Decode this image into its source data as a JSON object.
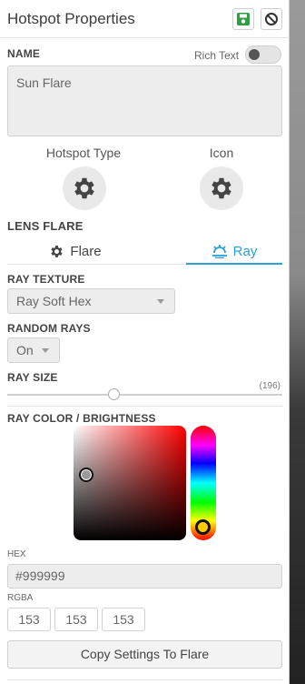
{
  "header": {
    "title": "Hotspot Properties",
    "save_icon": "save-icon",
    "disable_icon": "ban-icon",
    "save_color": "#2e9e44"
  },
  "name_section": {
    "label": "NAME",
    "rich_text_label": "Rich Text",
    "rich_text_enabled": false,
    "value": "Sun Flare"
  },
  "types": {
    "hotspot_type_label": "Hotspot Type",
    "icon_label": "Icon",
    "hotspot_type_icon": "gear-icon",
    "icon_icon": "gear-icon"
  },
  "lens_flare": {
    "label": "LENS FLARE",
    "tabs": [
      {
        "label": "Flare",
        "icon": "gear-icon",
        "active": false
      },
      {
        "label": "Ray",
        "icon": "ray-icon",
        "active": true
      }
    ],
    "accent": "#29a0d8"
  },
  "ray_texture": {
    "label": "RAY TEXTURE",
    "value": "Ray Soft Hex"
  },
  "random_rays": {
    "label": "RANDOM RAYS",
    "value": "On"
  },
  "ray_size": {
    "label": "RAY SIZE",
    "value_text": "(196)"
  },
  "ray_color": {
    "label": "RAY COLOR / BRIGHTNESS",
    "hex_label": "HEX",
    "hex_value": "#999999",
    "rgba_label": "RGBA",
    "rgba": [
      "153",
      "153",
      "153"
    ]
  },
  "copy_button": {
    "label": "Copy Settings To Flare"
  }
}
